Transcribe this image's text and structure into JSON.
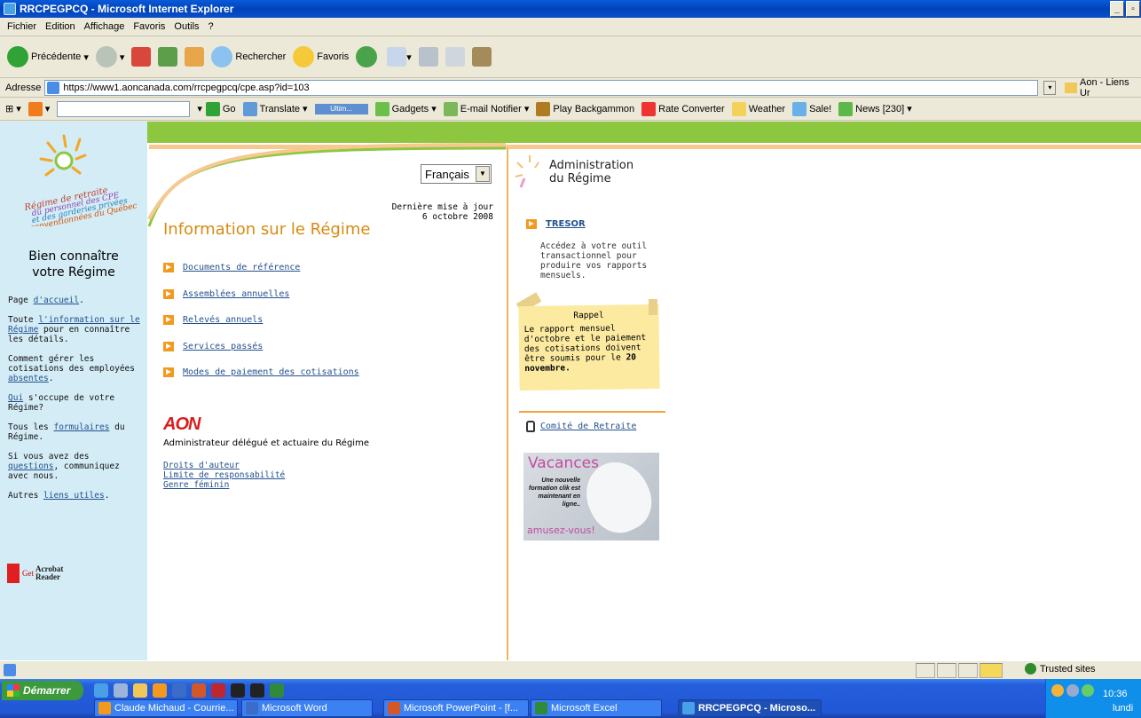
{
  "window": {
    "title": "RRCPEGPCQ - Microsoft Internet Explorer"
  },
  "menu": [
    "Fichier",
    "Edition",
    "Affichage",
    "Favoris",
    "Outils",
    "?"
  ],
  "toolbar": {
    "back": "Précédente",
    "search": "Rechercher",
    "favorites": "Favoris"
  },
  "address": {
    "label": "Adresse",
    "url": "https://www1.aoncanada.com/rrcpegpcq/cpe.asp?id=103",
    "links": "Aon - Liens Ur"
  },
  "links_bar": {
    "go": "Go",
    "translate": "Translate",
    "ultim": "Ultim...",
    "gadgets": "Gadgets",
    "email": "E-mail Notifier",
    "backgammon": "Play Backgammon",
    "rate": "Rate Converter",
    "weather": "Weather",
    "sale": "Sale!",
    "news": "News [230]"
  },
  "sidebar": {
    "heading_line1": "Bien connaître",
    "heading_line2": "votre Régime",
    "p1_pre": "Page ",
    "p1_link": "d'accueil",
    "p1_post": ".",
    "p2_pre": "Toute ",
    "p2_link": "l'information sur le Régime",
    "p2_post": " pour en connaître les détails.",
    "p3_pre": "Comment gérer les cotisations des employées ",
    "p3_link": "absentes",
    "p3_post": ".",
    "p4_link": "Qui",
    "p4_post": " s'occupe de votre Régime?",
    "p5_pre": "Tous les ",
    "p5_link": "formulaires",
    "p5_post": " du Régime.",
    "p6_pre": "Si vous avez des ",
    "p6_link": "questions",
    "p6_post": ", communiquez avec nous.",
    "p7_pre": "Autres ",
    "p7_link": "liens utiles",
    "p7_post": ".",
    "acrobat_get": "Get",
    "acrobat_name": "Acrobat Reader",
    "logo_text": "Régime de retraite du personnel des CPE et des garderies privées conventionnées du Québec"
  },
  "main": {
    "language": "Français",
    "updated_line1": "Dernière mise à jour",
    "updated_line2": "6 octobre 2008",
    "title": "Information sur le Régime",
    "items": [
      "Documents de référence",
      "Assemblées annuelles",
      "Relevés annuels",
      "Services passés",
      "Modes de paiement des cotisations"
    ],
    "aon_logo": "AON",
    "aon_desc": "Administrateur délégué et actuaire du Régime",
    "legal": [
      "Droits d'auteur",
      "Limite de responsabilité",
      "Genre féminin"
    ]
  },
  "admin": {
    "title_line1": "Administration",
    "title_line2": "du Régime",
    "tresor": "TRESOR",
    "tresor_desc": "Accédez à votre outil transactionnel pour produire vos rapports mensuels.",
    "note_title": "Rappel",
    "note_text": "Le rapport mensuel d'octobre et le paiement des cotisations doivent être soumis pour le ",
    "note_bold": "20 novembre.",
    "comite": "Comité de Retraite",
    "vac_title": "Vacances",
    "vac_body": "Une nouvelle formation clik est maintenant en ligne..",
    "vac_foot": "amusez-vous!"
  },
  "status": {
    "zone": "Trusted sites"
  },
  "taskbar": {
    "start": "Démarrer",
    "tasks": [
      "Claude Michaud - Courrie...",
      "Microsoft Word",
      "Microsoft PowerPoint - [f...",
      "Microsoft Excel",
      "RRCPEGPCQ - Microso..."
    ],
    "time": "10:36",
    "day": "lundi"
  }
}
